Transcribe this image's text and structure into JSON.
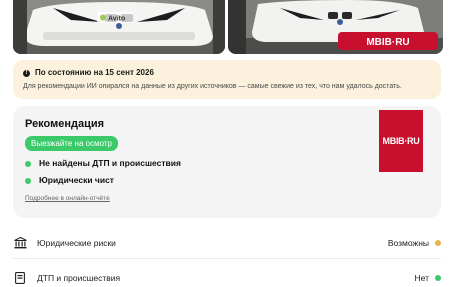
{
  "photos": {
    "left_watermark": "Avito",
    "right_watermark": "MBIB·RU"
  },
  "notice": {
    "title": "По состоянию на 15 сент 2026",
    "text": "Для рекомендации ИИ опирался на данные из других источников — самые свежие из тех, что нам удалось достать.",
    "icon": "warning-icon",
    "background": "#fbf1dc"
  },
  "recommendation": {
    "title": "Рекомендация",
    "badge": "Выезжайте на осмотр",
    "badge_color": "#3bc969",
    "checks": [
      "Не найдены ДТП и происшествия",
      "Юридически чист"
    ],
    "report_link": "Подробнее в онлайн-отчёте",
    "logo_text": "MBIB·RU",
    "logo_color": "#c8102e"
  },
  "rows": [
    {
      "label": "Юридические риски",
      "value": "Возможны",
      "icon": "bank-icon",
      "status_color": "#e6b54a"
    },
    {
      "label": "ДТП и происшествия",
      "value": "Нет",
      "icon": "document-icon",
      "status_color": "#3bc969"
    }
  ]
}
